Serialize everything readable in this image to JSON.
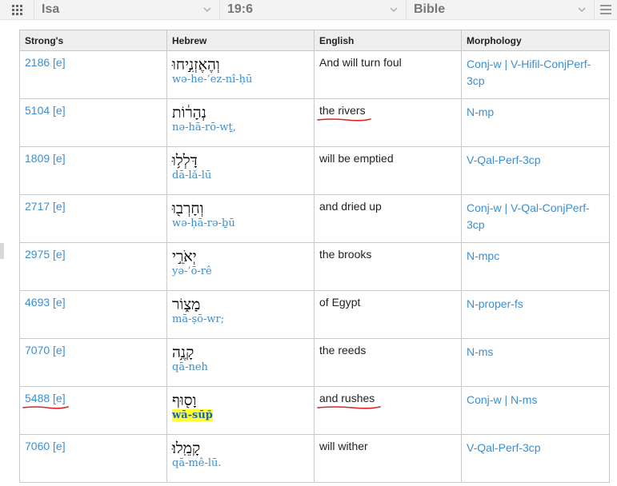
{
  "nav": {
    "book": "Isa",
    "reference": "19:6",
    "version": "Bible"
  },
  "table": {
    "headers": [
      "Strong's",
      "Hebrew",
      "English",
      "Morphology"
    ],
    "rows": [
      {
        "strongs": "2186 [e]",
        "hebrew": "וְהֶאֶזְנִ֣יחוּ",
        "translit": "wə-he-’ez-nî-ḥū",
        "english": "And will turn foul",
        "morph": "Conj-w | V-Hifil-ConjPerf-3cp"
      },
      {
        "strongs": "5104 [e]",
        "hebrew": "נְהָר֔וֹת",
        "translit": "nə-hā-rō-wṯ,",
        "english": "the rivers",
        "morph": "N-mp"
      },
      {
        "strongs": "1809 [e]",
        "hebrew": "דָּלְל֥וּ",
        "translit": "dā-lă-lū",
        "english": "will be emptied",
        "morph": "V-Qal-Perf-3cp"
      },
      {
        "strongs": "2717 [e]",
        "hebrew": "וְחָרְב֖וּ",
        "translit": "wə-ḥā-rə-ḇū",
        "english": "and dried up",
        "morph": "Conj-w | V-Qal-ConjPerf-3cp"
      },
      {
        "strongs": "2975 [e]",
        "hebrew": "יְאֹרֵ֣י",
        "translit": "yə-’ō-rê",
        "english": "the brooks",
        "morph": "N-mpc"
      },
      {
        "strongs": "4693 [e]",
        "hebrew": "מָצ֑וֹר",
        "translit": "mā-ṣō-wr;",
        "english": "of Egypt",
        "morph": "N-proper-fs"
      },
      {
        "strongs": "7070 [e]",
        "hebrew": "קָנֶ֥ה",
        "translit": "qā-neh",
        "english": "the reeds",
        "morph": "N-ms"
      },
      {
        "strongs": "5488 [e]",
        "hebrew": "וָס֖וּף",
        "translit": "wā-sūp̄",
        "english": "and rushes",
        "morph": "Conj-w | N-ms"
      },
      {
        "strongs": "7060 [e]",
        "hebrew": "קָמֵֽלוּ׃",
        "translit": "qā-mê-lū.",
        "english": "will wither",
        "morph": "V-Qal-Perf-3cp"
      }
    ]
  },
  "annotations": {
    "underline_color": "#dd2222",
    "highlight_color": "#ffff33"
  }
}
